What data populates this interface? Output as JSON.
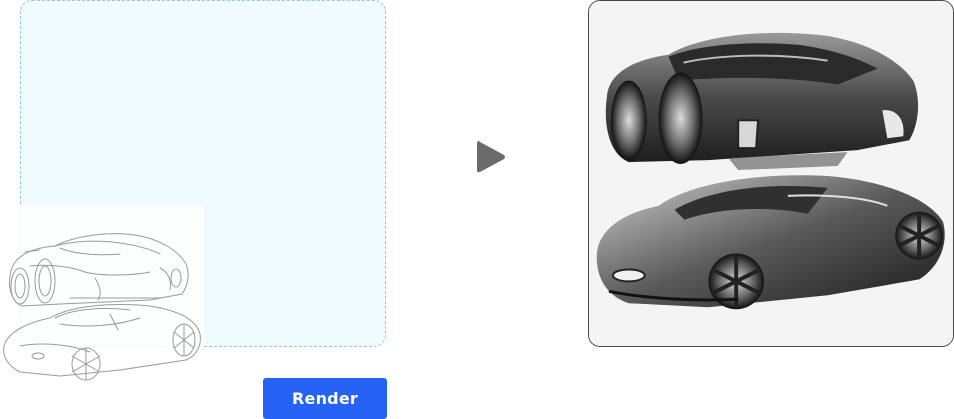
{
  "render_button": {
    "label": "Render"
  },
  "icons": {
    "arrow": "play-arrow-icon"
  },
  "colors": {
    "dropzone_bg": "#f0fbff",
    "dropzone_border": "#8ec9e6",
    "button_bg": "#2463f5",
    "arrow": "#6b6b6b",
    "output_border": "#4a4a4a"
  }
}
